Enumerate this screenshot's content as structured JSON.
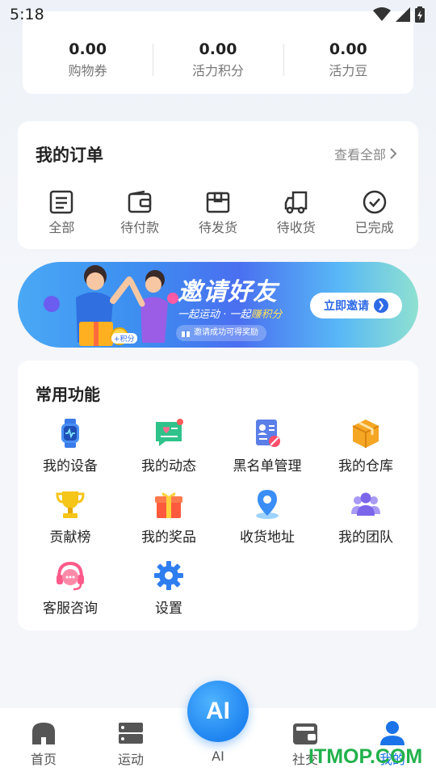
{
  "status_bar": {
    "time": "5:18"
  },
  "points": [
    {
      "value": "0.00",
      "label": "购物券"
    },
    {
      "value": "0.00",
      "label": "活力积分"
    },
    {
      "value": "0.00",
      "label": "活力豆"
    }
  ],
  "orders": {
    "title": "我的订单",
    "view_all": "查看全部",
    "items": [
      {
        "label": "全部",
        "icon": "list-icon"
      },
      {
        "label": "待付款",
        "icon": "wallet-icon"
      },
      {
        "label": "待发货",
        "icon": "box-icon"
      },
      {
        "label": "待收货",
        "icon": "truck-icon"
      },
      {
        "label": "已完成",
        "icon": "check-circle-icon"
      }
    ]
  },
  "banner": {
    "title": "邀请好友",
    "subtitle_part1": "一起运动 · 一起",
    "subtitle_highlight": "赚积分",
    "pill": "邀请成功可得奖励",
    "button": "立即邀请",
    "badge": "+积分"
  },
  "functions": {
    "title": "常用功能",
    "items": [
      {
        "label": "我的设备",
        "icon": "smartwatch-icon"
      },
      {
        "label": "我的动态",
        "icon": "message-icon"
      },
      {
        "label": "黑名单管理",
        "icon": "blacklist-icon"
      },
      {
        "label": "我的仓库",
        "icon": "warehouse-box-icon"
      },
      {
        "label": "贡献榜",
        "icon": "trophy-icon"
      },
      {
        "label": "我的奖品",
        "icon": "gift-icon"
      },
      {
        "label": "收货地址",
        "icon": "location-pin-icon"
      },
      {
        "label": "我的团队",
        "icon": "team-icon"
      },
      {
        "label": "客服咨询",
        "icon": "headset-icon"
      },
      {
        "label": "设置",
        "icon": "gear-icon"
      }
    ]
  },
  "bottom_nav": {
    "items": [
      {
        "label": "首页",
        "icon": "home-icon"
      },
      {
        "label": "运动",
        "icon": "sport-icon"
      },
      {
        "label": "AI",
        "icon": "ai-icon"
      },
      {
        "label": "社交",
        "icon": "social-icon"
      },
      {
        "label": "我的",
        "icon": "user-icon",
        "active": true
      }
    ],
    "ai_label": "AI"
  },
  "watermark": "ITMOP.COM",
  "colors": {
    "accent": "#1a73e8",
    "watermark": "#22b14c"
  }
}
